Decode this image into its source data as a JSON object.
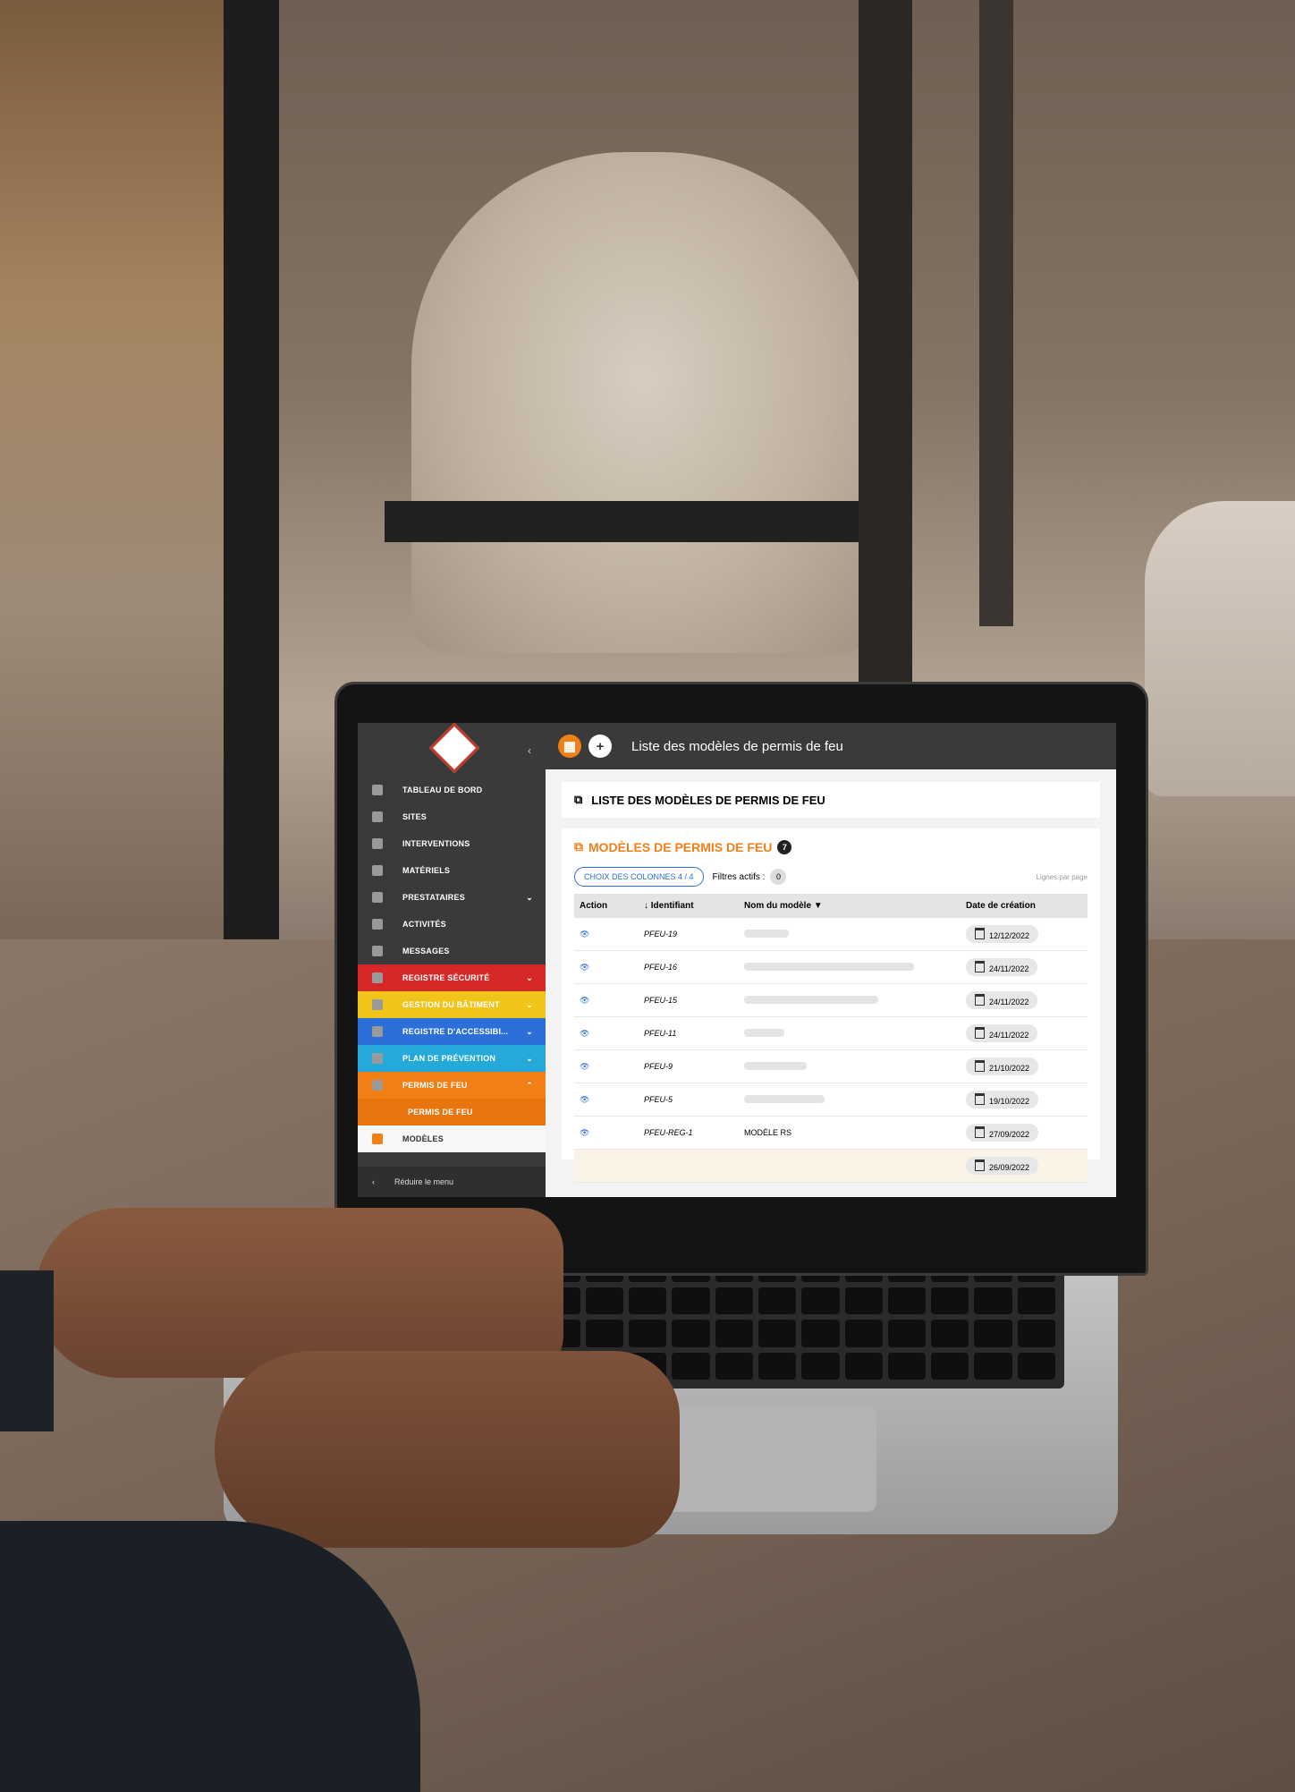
{
  "sidebar": {
    "items": [
      {
        "label": "TABLEAU DE BORD",
        "icon": "dashboard-icon"
      },
      {
        "label": "SITES",
        "icon": "sites-icon"
      },
      {
        "label": "INTERVENTIONS",
        "icon": "interventions-icon"
      },
      {
        "label": "MATÉRIELS",
        "icon": "materials-icon"
      },
      {
        "label": "PRESTATAIRES",
        "icon": "providers-icon"
      },
      {
        "label": "ACTIVITÉS",
        "icon": "activities-icon"
      },
      {
        "label": "MESSAGES",
        "icon": "messages-icon"
      },
      {
        "label": "REGISTRE SÉCURITÉ",
        "icon": "security-register-icon",
        "color": "#d62828"
      },
      {
        "label": "GESTION DU BÂTIMENT",
        "icon": "building-icon",
        "color": "#f0c419"
      },
      {
        "label": "REGISTRE D'ACCESSIBI...",
        "icon": "accessibility-icon",
        "color": "#2d6fd8"
      },
      {
        "label": "PLAN DE PRÉVENTION",
        "icon": "prevention-icon",
        "color": "#25a9d8"
      },
      {
        "label": "PERMIS DE FEU",
        "icon": "fire-permit-icon",
        "color": "#f07f16"
      },
      {
        "label": "PERMIS DE FEU"
      },
      {
        "label": "MODÈLES",
        "icon": "templates-icon"
      }
    ],
    "reduce_label": "Réduire le menu"
  },
  "topbar": {
    "title": "Liste des modèles de permis de feu"
  },
  "header_card": {
    "title": "LISTE DES MODÈLES DE PERMIS DE FEU"
  },
  "models_card": {
    "title": "MODÈLES DE PERMIS DE FEU",
    "count": "7",
    "columns_button": "CHOIX DES COLONNES 4 / 4",
    "filters_label": "Filtres actifs :",
    "filters_count": "0",
    "lines_per_page": "Lignes par page"
  },
  "table": {
    "headers": {
      "action": "Action",
      "id": "↓ Identifiant",
      "name": "Nom du modèle",
      "date": "Date de création"
    },
    "rows": [
      {
        "id": "PFEU-19",
        "name": "",
        "date": "12/12/2022"
      },
      {
        "id": "PFEU-16",
        "name": "",
        "date": "24/11/2022"
      },
      {
        "id": "PFEU-15",
        "name": "",
        "date": "24/11/2022"
      },
      {
        "id": "PFEU-11",
        "name": "",
        "date": "24/11/2022"
      },
      {
        "id": "PFEU-9",
        "name": "",
        "date": "21/10/2022"
      },
      {
        "id": "PFEU-5",
        "name": "",
        "date": "19/10/2022"
      },
      {
        "id": "PFEU-REG-1",
        "name": "MODÈLE RS",
        "date": "27/09/2022"
      },
      {
        "id": "",
        "name": "",
        "date": "26/09/2022"
      }
    ]
  },
  "colors": {
    "accent": "#f07f16",
    "link": "#2d6fd8",
    "chrome": "#3a3a3a"
  }
}
